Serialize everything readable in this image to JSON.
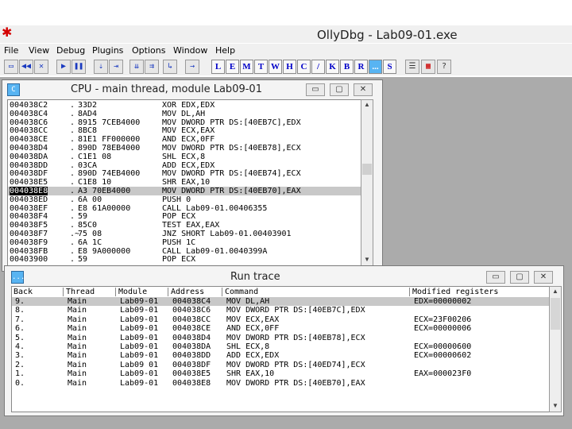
{
  "app": {
    "title": "OllyDbg - Lab09-01.exe",
    "icon": "bug-icon"
  },
  "menu": [
    "File",
    "View",
    "Debug",
    "Plugins",
    "Options",
    "Window",
    "Help"
  ],
  "toolbar": {
    "buttons": [
      {
        "name": "open-button",
        "glyph": "▭"
      },
      {
        "name": "restart-button",
        "glyph": "◀◀"
      },
      {
        "name": "close-button",
        "glyph": "✕"
      },
      {
        "name": "run-button",
        "glyph": "▶"
      },
      {
        "name": "pause-button",
        "glyph": "❚❚"
      },
      {
        "name": "step-into-button",
        "glyph": "⇣"
      },
      {
        "name": "step-over-button",
        "glyph": "⇥"
      },
      {
        "name": "trace-into-button",
        "glyph": "⇊"
      },
      {
        "name": "trace-over-button",
        "glyph": "⇉"
      },
      {
        "name": "execute-till-return-button",
        "glyph": "↳"
      },
      {
        "name": "goto-button",
        "glyph": "→"
      }
    ],
    "letters": [
      "L",
      "E",
      "M",
      "T",
      "W",
      "H",
      "C",
      "/",
      "K",
      "B",
      "R",
      "...",
      "S"
    ]
  },
  "cpu": {
    "title": "CPU - main thread, module Lab09-01",
    "icon_label": "C",
    "rows": [
      {
        "addr": "004038C2",
        "mark": ".",
        "hex": "33D2",
        "dis": "XOR EDX,EDX"
      },
      {
        "addr": "004038C4",
        "mark": ".",
        "hex": "8AD4",
        "dis": "MOV DL,AH"
      },
      {
        "addr": "004038C6",
        "mark": ".",
        "hex": "8915 7CEB4000",
        "dis": "MOV DWORD PTR DS:[40EB7C],EDX"
      },
      {
        "addr": "004038CC",
        "mark": ".",
        "hex": "8BC8",
        "dis": "MOV ECX,EAX"
      },
      {
        "addr": "004038CE",
        "mark": ".",
        "hex": "81E1 FF000000",
        "dis": "AND ECX,0FF"
      },
      {
        "addr": "004038D4",
        "mark": ".",
        "hex": "890D 78EB4000",
        "dis": "MOV DWORD PTR DS:[40EB78],ECX"
      },
      {
        "addr": "004038DA",
        "mark": ".",
        "hex": "C1E1 08",
        "dis": "SHL ECX,8"
      },
      {
        "addr": "004038DD",
        "mark": ".",
        "hex": "03CA",
        "dis": "ADD ECX,EDX"
      },
      {
        "addr": "004038DF",
        "mark": ".",
        "hex": "890D 74EB4000",
        "dis": "MOV DWORD PTR DS:[40EB74],ECX"
      },
      {
        "addr": "004038E5",
        "mark": ".",
        "hex": "C1E8 10",
        "dis": "SHR EAX,10"
      },
      {
        "addr": "004038E8",
        "mark": ".",
        "hex": "A3 70EB4000",
        "dis": "MOV DWORD PTR DS:[40EB70],EAX"
      },
      {
        "addr": "004038ED",
        "mark": ".",
        "hex": "6A 00",
        "dis": "PUSH 0"
      },
      {
        "addr": "004038EF",
        "mark": ".",
        "hex": "E8 61A00000",
        "dis": "CALL Lab09-01.00406355"
      },
      {
        "addr": "004038F4",
        "mark": ".",
        "hex": "59",
        "dis": "POP ECX"
      },
      {
        "addr": "004038F5",
        "mark": ".",
        "hex": "85C0",
        "dis": "TEST EAX,EAX"
      },
      {
        "addr": "004038F7",
        "mark": ".~",
        "hex": "75 08",
        "dis": "JNZ SHORT Lab09-01.00403901"
      },
      {
        "addr": "004038F9",
        "mark": ".",
        "hex": "6A 1C",
        "dis": "PUSH 1C"
      },
      {
        "addr": "004038FB",
        "mark": ".",
        "hex": "E8 9A000000",
        "dis": "CALL Lab09-01.0040399A"
      },
      {
        "addr": "00403900",
        "mark": ".",
        "hex": "59",
        "dis": "POP ECX"
      }
    ],
    "selected_index": 10
  },
  "runtrace": {
    "title": "Run trace",
    "icon_label": "...",
    "columns": [
      "Back",
      "Thread",
      "Module",
      "Address",
      "Command",
      "Modified registers"
    ],
    "rows": [
      {
        "back": "9.",
        "thread": "Main",
        "module": "Lab09-01",
        "address": "004038C4",
        "command": "MOV DL,AH",
        "regs": "EDX=00000002"
      },
      {
        "back": "8.",
        "thread": "Main",
        "module": "Lab09-01",
        "address": "004038C6",
        "command": "MOV DWORD PTR DS:[40EB7C],EDX",
        "regs": ""
      },
      {
        "back": "7.",
        "thread": "Main",
        "module": "Lab09-01",
        "address": "004038CC",
        "command": "MOV ECX,EAX",
        "regs": "ECX=23F00206"
      },
      {
        "back": "6.",
        "thread": "Main",
        "module": "Lab09-01",
        "address": "004038CE",
        "command": "AND ECX,0FF",
        "regs": "ECX=00000006"
      },
      {
        "back": "5.",
        "thread": "Main",
        "module": "Lab09-01",
        "address": "004038D4",
        "command": "MOV DWORD PTR DS:[40EB78],ECX",
        "regs": ""
      },
      {
        "back": "4.",
        "thread": "Main",
        "module": "Lab09-01",
        "address": "004038DA",
        "command": "SHL ECX,8",
        "regs": "ECX=00000600"
      },
      {
        "back": "3.",
        "thread": "Main",
        "module": "Lab09-01",
        "address": "004038DD",
        "command": "ADD ECX,EDX",
        "regs": "ECX=00000602"
      },
      {
        "back": "2.",
        "thread": "Main",
        "module": "Lab09 01",
        "address": "004038DF",
        "command": "MOV DWORD PTR DS:[40ED74],ECX",
        "regs": ""
      },
      {
        "back": "1.",
        "thread": "Main",
        "module": "Lab09-01",
        "address": "004038E5",
        "command": "SHR EAX,10",
        "regs": "EAX=000023F0"
      },
      {
        "back": "0.",
        "thread": "Main",
        "module": "Lab09-01",
        "address": "004038E8",
        "command": "MOV DWORD PTR DS:[40EB70],EAX",
        "regs": ""
      }
    ],
    "selected_index": 0
  },
  "window_buttons": {
    "minimize": "▭",
    "restore": "▢",
    "close": "✕"
  }
}
